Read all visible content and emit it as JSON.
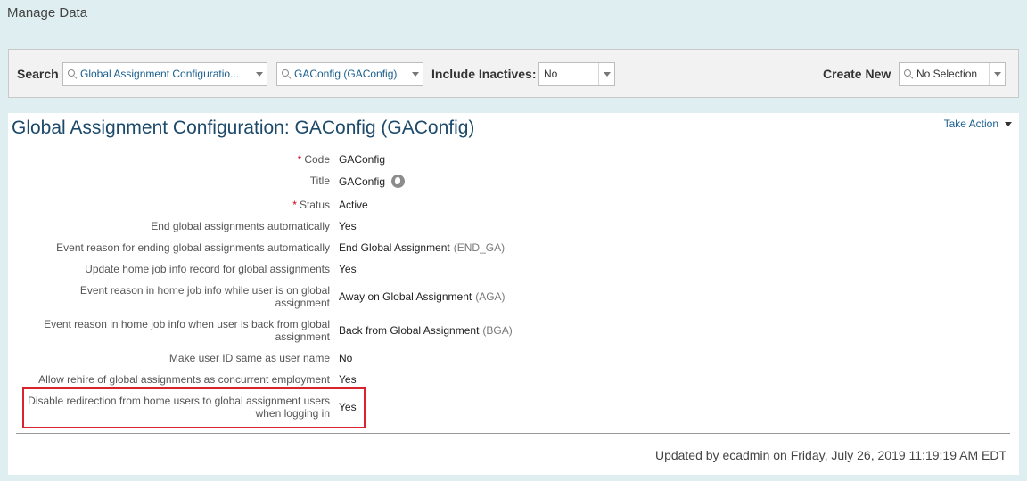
{
  "header": {
    "title": "Manage Data"
  },
  "search_bar": {
    "search_label": "Search",
    "search_type_value": "Global Assignment Configuratio...",
    "search_record_value": "GAConfig (GAConfig)",
    "include_inactives_label": "Include Inactives:",
    "include_inactives_value": "No",
    "create_new_label": "Create New",
    "create_new_value": "No Selection"
  },
  "record": {
    "title": "Global Assignment Configuration: GAConfig (GAConfig)",
    "take_action": "Take Action",
    "fields": [
      {
        "label": "Code",
        "required": "*",
        "value": "GAConfig",
        "code": ""
      },
      {
        "label": "Title",
        "required": "",
        "value": "GAConfig",
        "code": ""
      },
      {
        "label": "Status",
        "required": "*",
        "value": "Active",
        "code": ""
      },
      {
        "label": "End global assignments automatically",
        "required": "",
        "value": "Yes",
        "code": ""
      },
      {
        "label": "Event reason for ending global assignments automatically",
        "required": "",
        "value": "End Global Assignment",
        "code": "(END_GA)"
      },
      {
        "label": "Update home job info record for global assignments",
        "required": "",
        "value": "Yes",
        "code": ""
      },
      {
        "label": "Event reason in home job info while user is on global assignment",
        "required": "",
        "value": "Away on Global Assignment",
        "code": "(AGA)"
      },
      {
        "label": "Event reason in home job info when user is back from global assignment",
        "required": "",
        "value": "Back from Global Assignment",
        "code": "(BGA)"
      },
      {
        "label": "Make user ID same as user name",
        "required": "",
        "value": "No",
        "code": ""
      },
      {
        "label": "Allow rehire of global assignments as concurrent employment",
        "required": "",
        "value": "Yes",
        "code": ""
      },
      {
        "label": "Disable redirection from home users to global assignment users when logging in",
        "required": "",
        "value": "Yes",
        "code": ""
      }
    ],
    "footer": "Updated by ecadmin on Friday, July 26, 2019 11:19:19 AM EDT"
  },
  "icons": {
    "title_translation": "globe-icon"
  },
  "colors": {
    "highlight": "#d9232d",
    "title": "#1d4a6b",
    "link": "#1a5f8e",
    "required": "#d0021b"
  }
}
